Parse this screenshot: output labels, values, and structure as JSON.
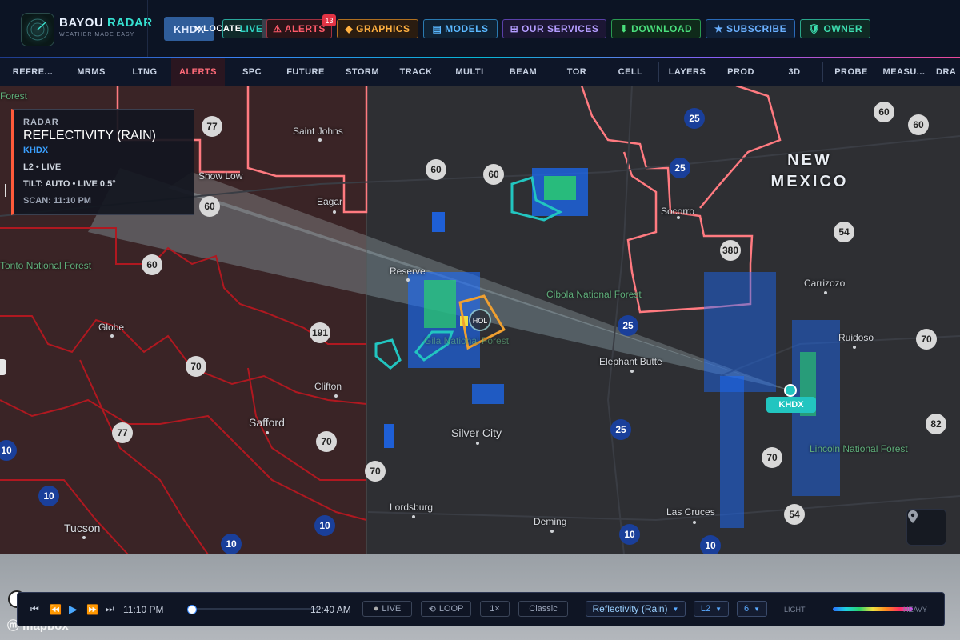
{
  "brand": {
    "name_a": "BAYOU",
    "name_b": "RADAR",
    "tagline": "WEATHER MADE EASY"
  },
  "header": {
    "site_button": "KHDX",
    "locate": "LOCATE",
    "live": "LIVE",
    "alerts": "⚠ ALERTS",
    "alerts_count": "13",
    "graphics": "◆ GRAPHICS",
    "models": "▤ MODELS",
    "services": "⊞ OUR SERVICES",
    "download": "⬇ DOWNLOAD",
    "subscribe": "★ SUBSCRIBE",
    "owner": "🛡 OWNER"
  },
  "toolbar": {
    "items": [
      "REFRE...",
      "MRMS",
      "LTNG",
      "ALERTS",
      "SPC",
      "FUTURE",
      "STORM",
      "TRACK",
      "MULTI",
      "BEAM",
      "TOR",
      "CELL",
      "LAYERS",
      "PROD",
      "3D",
      "PROBE",
      "MEASU...",
      "DRA"
    ],
    "active": "ALERTS"
  },
  "info_panel": {
    "kicker": "RADAR",
    "title": "REFLECTIVITY (RAIN)",
    "site": "KHDX",
    "row1": "L2 • LIVE",
    "row2": "TILT: AUTO • LIVE 0.5°",
    "row3": "SCAN: 11:10 PM"
  },
  "map": {
    "state_label": "NEW\nMEXICO",
    "cities": [
      {
        "name": "Saint Johns"
      },
      {
        "name": "Show Low"
      },
      {
        "name": "Eagar"
      },
      {
        "name": "Socorro"
      },
      {
        "name": "Reserve"
      },
      {
        "name": "Carrizozo"
      },
      {
        "name": "Ruidoso"
      },
      {
        "name": "Globe"
      },
      {
        "name": "Elephant Butte"
      },
      {
        "name": "Clifton"
      },
      {
        "name": "Safford"
      },
      {
        "name": "Silver City"
      },
      {
        "name": "Lordsburg"
      },
      {
        "name": "Deming"
      },
      {
        "name": "Las Cruces"
      },
      {
        "name": "Tucson"
      }
    ],
    "forests": [
      "Cibola National Forest",
      "Gila National Forest",
      "Lincoln National Forest",
      "Tonto National Forest",
      "Forest"
    ],
    "site_tag": "KHDX",
    "storm_id": "HOL",
    "highway_shields": [
      "77",
      "60",
      "60",
      "60",
      "60",
      "25",
      "25",
      "60",
      "54",
      "380",
      "191",
      "70",
      "25",
      "70",
      "70",
      "25",
      "82",
      "77",
      "10",
      "10",
      "70",
      "10",
      "10",
      "54",
      "10",
      "10"
    ]
  },
  "player": {
    "time_start": "11:10 PM",
    "time_end": "12:40 AM",
    "progress": 0,
    "live": "LIVE",
    "loop": "LOOP",
    "speed": "1×",
    "style": "Classic",
    "product": "Reflectivity (Rain)",
    "level": "L2",
    "frames": "6",
    "legend_light": "LIGHT",
    "legend_heavy": "HEAVY"
  },
  "attribution": "mapbox",
  "colors": {
    "accent": "#22c5c0",
    "alert": "#ff5a6a",
    "warning_border": "#f0a030"
  }
}
